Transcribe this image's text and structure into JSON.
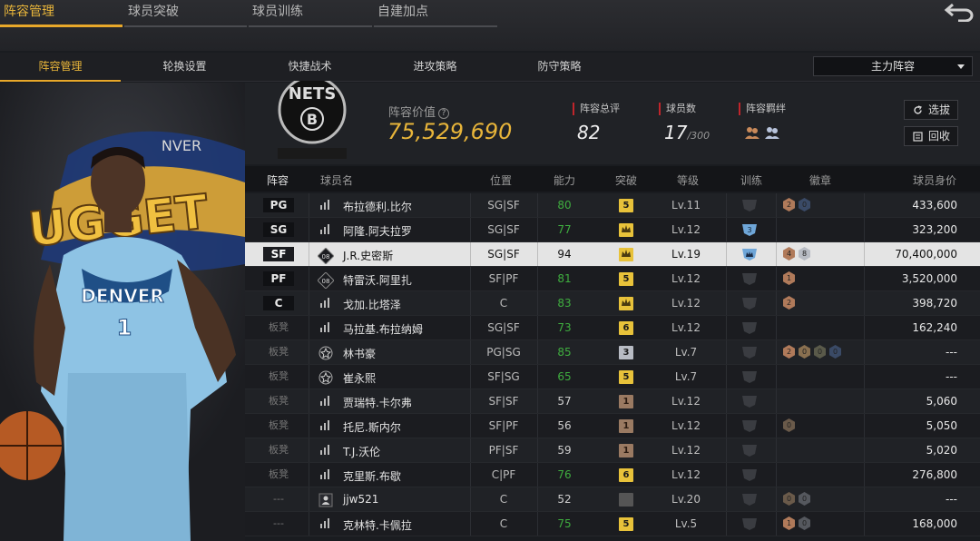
{
  "top_tabs": [
    {
      "label": "阵容管理",
      "active": true
    },
    {
      "label": "球员突破",
      "active": false
    },
    {
      "label": "球员训练",
      "active": false
    },
    {
      "label": "自建加点",
      "active": false
    }
  ],
  "sub_tabs": [
    {
      "label": "阵容管理",
      "active": true
    },
    {
      "label": "轮换设置",
      "active": false
    },
    {
      "label": "快捷战术",
      "active": false
    },
    {
      "label": "进攻策略",
      "active": false
    },
    {
      "label": "防守策略",
      "active": false
    }
  ],
  "lineup_select": "主力阵容",
  "summary": {
    "value_label": "阵容价值",
    "value": "75,529,690",
    "rating_label": "阵容总评",
    "rating": "82",
    "count_label": "球员数",
    "count": "17",
    "count_max": "/300",
    "bond_label": "阵容羁绊",
    "select_btn": "选拔",
    "recycle_btn": "回收"
  },
  "columns": [
    "阵容",
    "球员名",
    "位置",
    "能力",
    "突破",
    "等级",
    "训练",
    "徽章",
    "球员身价"
  ],
  "players": [
    {
      "slot": "PG",
      "icon": "bars",
      "name": "布拉德利.比尔",
      "pos": "SG|SF",
      "ability": "80",
      "ability_color": "#3fae3f",
      "break": "5",
      "break_color": "#e8c23a",
      "level": "Lv.11",
      "train": "",
      "badges": [
        {
          "t": "2",
          "c": "#b07a5a"
        },
        {
          "t": "0",
          "c": "#3a4a66"
        }
      ],
      "price": "433,600"
    },
    {
      "slot": "SG",
      "icon": "bars",
      "name": "阿隆.阿夫拉罗",
      "pos": "SG|SF",
      "ability": "77",
      "ability_color": "#3fae3f",
      "break": "crown",
      "break_color": "#e8c23a",
      "level": "Lv.12",
      "train": "3",
      "badges": [],
      "price": "323,200"
    },
    {
      "slot": "SF",
      "icon": "08",
      "name": "J.R.史密斯",
      "pos": "SG|SF",
      "ability": "94",
      "ability_color": "#111111",
      "break": "crown",
      "break_color": "#e8c23a",
      "level": "Lv.19",
      "train": "crown",
      "badges": [
        {
          "t": "4",
          "c": "#b07a5a"
        },
        {
          "t": "8",
          "c": "#b8bcc4"
        }
      ],
      "price": "70,400,000",
      "selected": true
    },
    {
      "slot": "PF",
      "icon": "08",
      "name": "特雷沃.阿里扎",
      "pos": "SF|PF",
      "ability": "81",
      "ability_color": "#3fae3f",
      "break": "5",
      "break_color": "#e8c23a",
      "level": "Lv.12",
      "train": "",
      "badges": [
        {
          "t": "1",
          "c": "#b07a5a"
        }
      ],
      "price": "3,520,000"
    },
    {
      "slot": "C",
      "icon": "bars",
      "name": "戈加.比塔泽",
      "pos": "C",
      "ability": "83",
      "ability_color": "#3fae3f",
      "break": "crown",
      "break_color": "#e8c23a",
      "level": "Lv.12",
      "train": "",
      "badges": [
        {
          "t": "2",
          "c": "#b07a5a"
        }
      ],
      "price": "398,720"
    },
    {
      "slot": "板凳",
      "icon": "bars",
      "name": "马拉基.布拉纳姆",
      "pos": "SG|SF",
      "ability": "73",
      "ability_color": "#3fae3f",
      "break": "6",
      "break_color": "#e8c23a",
      "level": "Lv.12",
      "train": "",
      "badges": [],
      "price": "162,240"
    },
    {
      "slot": "板凳",
      "icon": "star",
      "name": "林书豪",
      "pos": "PG|SG",
      "ability": "85",
      "ability_color": "#3fae3f",
      "break": "3",
      "break_color": "#b8bcc4",
      "level": "Lv.7",
      "train": "",
      "badges": [
        {
          "t": "2",
          "c": "#b07a5a"
        },
        {
          "t": "0",
          "c": "#8a7050"
        },
        {
          "t": "0",
          "c": "#5a5a4a"
        },
        {
          "t": "0",
          "c": "#3a4a66"
        }
      ],
      "price": "---"
    },
    {
      "slot": "板凳",
      "icon": "star",
      "name": "崔永熙",
      "pos": "SF|SG",
      "ability": "65",
      "ability_color": "#3fae3f",
      "break": "5",
      "break_color": "#e8c23a",
      "level": "Lv.7",
      "train": "",
      "badges": [],
      "price": "---"
    },
    {
      "slot": "板凳",
      "icon": "bars",
      "name": "贾瑞特.卡尔弗",
      "pos": "SF|SF",
      "ability": "57",
      "ability_color": "#cfcfcf",
      "break": "1",
      "break_color": "#9a7a62",
      "level": "Lv.12",
      "train": "",
      "badges": [],
      "price": "5,060"
    },
    {
      "slot": "板凳",
      "icon": "bars",
      "name": "托尼.斯内尔",
      "pos": "SF|PF",
      "ability": "56",
      "ability_color": "#cfcfcf",
      "break": "1",
      "break_color": "#9a7a62",
      "level": "Lv.12",
      "train": "",
      "badges": [
        {
          "t": "0",
          "c": "#6a5a4a"
        }
      ],
      "price": "5,050"
    },
    {
      "slot": "板凳",
      "icon": "bars",
      "name": "T.J.沃伦",
      "pos": "PF|SF",
      "ability": "59",
      "ability_color": "#cfcfcf",
      "break": "1",
      "break_color": "#9a7a62",
      "level": "Lv.12",
      "train": "",
      "badges": [],
      "price": "5,020"
    },
    {
      "slot": "板凳",
      "icon": "bars",
      "name": "克里斯.布歇",
      "pos": "C|PF",
      "ability": "76",
      "ability_color": "#3fae3f",
      "break": "6",
      "break_color": "#e8c23a",
      "level": "Lv.12",
      "train": "",
      "badges": [],
      "price": "276,800"
    },
    {
      "slot": "---",
      "icon": "person",
      "name": "jjw521",
      "pos": "C",
      "ability": "52",
      "ability_color": "#cfcfcf",
      "break": "",
      "break_color": "#555555",
      "level": "Lv.20",
      "train": "",
      "badges": [
        {
          "t": "0",
          "c": "#6a5a4a"
        },
        {
          "t": "0",
          "c": "#55585e"
        }
      ],
      "price": "---"
    },
    {
      "slot": "---",
      "icon": "bars",
      "name": "克林特.卡佩拉",
      "pos": "C",
      "ability": "75",
      "ability_color": "#3fae3f",
      "break": "5",
      "break_color": "#e8c23a",
      "level": "Lv.5",
      "train": "",
      "badges": [
        {
          "t": "1",
          "c": "#b07a5a"
        },
        {
          "t": "0",
          "c": "#55585e"
        }
      ],
      "price": "168,000"
    }
  ],
  "team_logo_text": "NETS",
  "jersey_text": "DENVER",
  "jersey_number": "1"
}
